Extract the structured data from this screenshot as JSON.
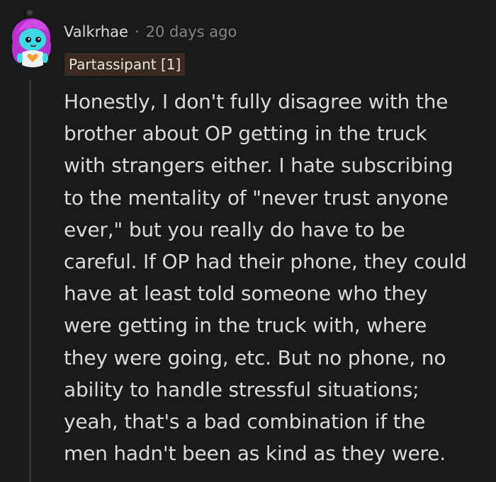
{
  "comment": {
    "username": "Valkrhae",
    "separator": "·",
    "timestamp": "20 days ago",
    "flair": "Partassipant [1]",
    "body_lines": [
      "Honestly, I don't fully disagree with the",
      "brother about OP getting in the truck",
      "with strangers either. I hate subscribing",
      "to the mentality of \"never trust anyone",
      "ever,\" but you really do have to be",
      "careful. If OP had their phone, they could",
      "have at least told someone who they",
      "were getting in the truck with, where",
      "they were going, etc. But no phone, no",
      "ability to handle stressful situations;",
      "yeah, that's a bad combination if the",
      "men hadn't been as kind as they were."
    ]
  },
  "colors": {
    "background": "#1a1a1b",
    "text": "#d7dadc",
    "meta_text": "#818384",
    "flair_bg": "#3a2a20",
    "thread_line": "#343536",
    "avatar_hair": "#c040d8",
    "avatar_skin": "#40e0e8"
  },
  "icons": {
    "avatar": "snoo-avatar-icon"
  }
}
